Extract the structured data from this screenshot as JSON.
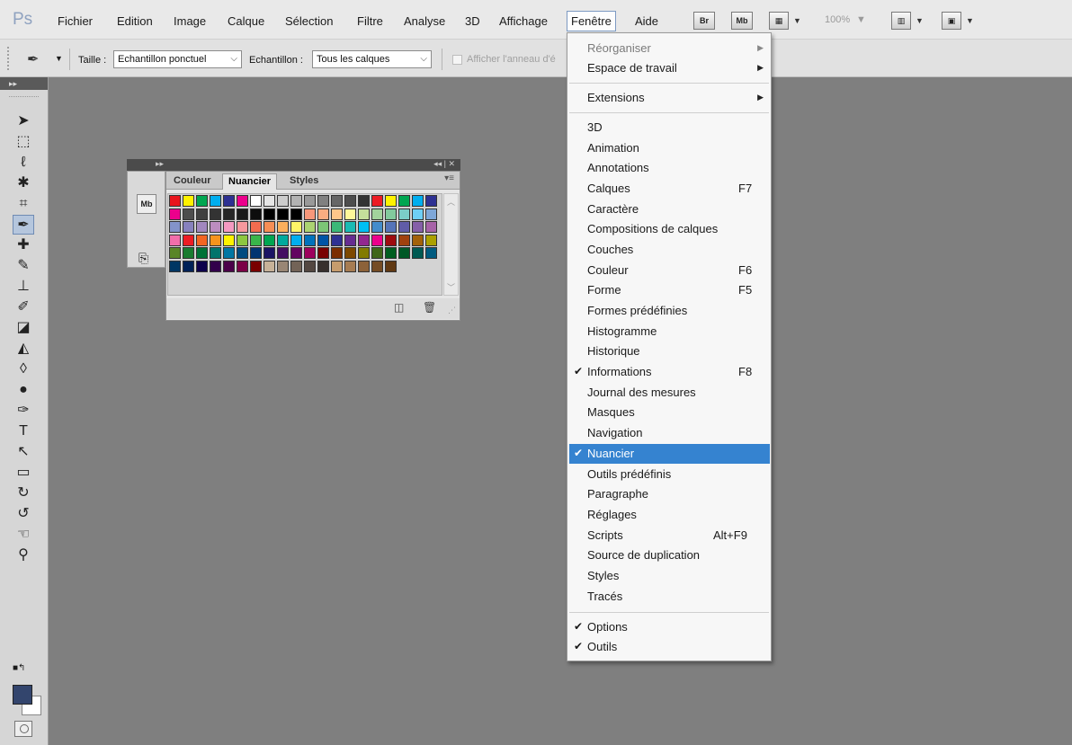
{
  "menubar": {
    "logo": "Ps",
    "items": [
      "Fichier",
      "Edition",
      "Image",
      "Calque",
      "Sélection",
      "Filtre",
      "Analyse",
      "3D",
      "Affichage",
      "Fenêtre",
      "Aide"
    ],
    "bridge": "Br",
    "minibridge": "Mb",
    "zoom": "100%"
  },
  "options": {
    "size_label": "Taille :",
    "size_value": "Echantillon ponctuel",
    "sample_label": "Echantillon :",
    "sample_value": "Tous les calques",
    "ring_label": "Afficher l'anneau d'é"
  },
  "swatches_panel": {
    "side_icon": "Mb",
    "tabs": [
      "Couleur",
      "Nuancier",
      "Styles"
    ],
    "active_tab": "Nuancier",
    "colors": [
      [
        "#e8141c",
        "#fff200",
        "#00a651",
        "#00aeef",
        "#2e3192",
        "#ec008c",
        "#ffffff",
        "#e5e5e5",
        "#cccccc",
        "#b2b2b2",
        "#999999",
        "#808080",
        "#666666",
        "#4d4d4d",
        "#333333",
        "#ed1c24",
        "#fff200",
        "#00a651",
        "#00aeef",
        "#2e3192"
      ],
      [
        "#ec008c",
        "#4d4d4d",
        "#404040",
        "#333333",
        "#262626",
        "#1a1a1a",
        "#0d0d0d",
        "#000000",
        "#000000",
        "#000000",
        "#f7977a",
        "#f9ad81",
        "#fdc68a",
        "#fff79a",
        "#c4df9b",
        "#a2d39c",
        "#82ca9d",
        "#7bcdc8",
        "#6ecff6",
        "#7ea7d8"
      ],
      [
        "#8393ca",
        "#8781bd",
        "#a187be",
        "#bc8dbf",
        "#f49ac1",
        "#f6989d",
        "#f26c4f",
        "#f68e55",
        "#fbaf5c",
        "#fff467",
        "#acd372",
        "#7cc576",
        "#3bb878",
        "#1abbb4",
        "#00bff3",
        "#448ccb",
        "#5574b9",
        "#605ca8",
        "#855fa8",
        "#a763a8"
      ],
      [
        "#f06eaa",
        "#ed1c24",
        "#f26522",
        "#f7941d",
        "#fff200",
        "#8dc73f",
        "#39b54a",
        "#00a651",
        "#00a99d",
        "#00aeef",
        "#0072bc",
        "#0054a6",
        "#2e3192",
        "#662d91",
        "#92278f",
        "#ec008c",
        "#9e0b0f",
        "#a0410d",
        "#a3620a",
        "#aba000"
      ],
      [
        "#598527",
        "#197b30",
        "#007236",
        "#00746b",
        "#0076a3",
        "#004b80",
        "#003471",
        "#1b1464",
        "#440e62",
        "#630460",
        "#9e005d",
        "#790000",
        "#7b2e00",
        "#7d4900",
        "#827b00",
        "#406618",
        "#005e20",
        "#005826",
        "#005952",
        "#005b7f"
      ],
      [
        "#003663",
        "#002157",
        "#0d004c",
        "#32004b",
        "#4b0049",
        "#7b0046",
        "#790000",
        "#c7b299",
        "#998675",
        "#736357",
        "#534741",
        "#37302d",
        "#c69c6d",
        "#a67c52",
        "#8c6239",
        "#754c24",
        "#603913"
      ]
    ]
  },
  "window_menu": {
    "items": [
      {
        "label": "Réorganiser",
        "dim": true,
        "submenu": true
      },
      {
        "label": "Espace de travail",
        "submenu": true
      },
      {
        "label": "Extensions",
        "submenu": true
      },
      {
        "label": "3D"
      },
      {
        "label": "Animation"
      },
      {
        "label": "Annotations"
      },
      {
        "label": "Calques",
        "shortcut": "F7"
      },
      {
        "label": "Caractère"
      },
      {
        "label": "Compositions de calques"
      },
      {
        "label": "Couches"
      },
      {
        "label": "Couleur",
        "shortcut": "F6"
      },
      {
        "label": "Forme",
        "shortcut": "F5"
      },
      {
        "label": "Formes prédéfinies"
      },
      {
        "label": "Histogramme"
      },
      {
        "label": "Historique"
      },
      {
        "label": "Informations",
        "shortcut": "F8",
        "checked": true
      },
      {
        "label": "Journal des mesures"
      },
      {
        "label": "Masques"
      },
      {
        "label": "Navigation"
      },
      {
        "label": "Nuancier",
        "checked": true,
        "highlighted": true
      },
      {
        "label": "Outils prédéfinis"
      },
      {
        "label": "Paragraphe"
      },
      {
        "label": "Réglages"
      },
      {
        "label": "Scripts",
        "shortcut": "Alt+F9"
      },
      {
        "label": "Source de duplication"
      },
      {
        "label": "Styles"
      },
      {
        "label": "Tracés"
      },
      {
        "label": "Options",
        "checked": true
      },
      {
        "label": "Outils",
        "checked": true
      }
    ],
    "highlight_color": "#3583d0"
  },
  "tools": {
    "foreground_color": "#33456d",
    "background_color": "#ffffff",
    "icons": [
      "move-icon",
      "marquee-icon",
      "lasso-icon",
      "quick-select-icon",
      "crop-icon",
      "eyedropper-icon",
      "healing-icon",
      "brush-icon",
      "stamp-icon",
      "history-brush-icon",
      "eraser-icon",
      "paint-bucket-icon",
      "blur-icon",
      "dodge-icon",
      "pen-icon",
      "type-icon",
      "path-select-icon",
      "shape-icon",
      "3d-rotate-icon",
      "3d-orbit-icon",
      "hand-icon",
      "zoom-icon"
    ]
  }
}
